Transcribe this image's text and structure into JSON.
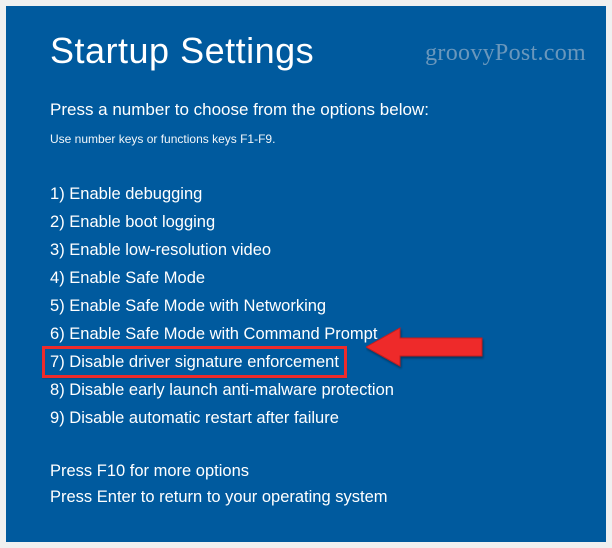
{
  "title": "Startup Settings",
  "subtitle": "Press a number to choose from the options below:",
  "hint": "Use number keys or functions keys F1-F9.",
  "options": [
    {
      "n": "1",
      "label": "Enable debugging"
    },
    {
      "n": "2",
      "label": "Enable boot logging"
    },
    {
      "n": "3",
      "label": "Enable low-resolution video"
    },
    {
      "n": "4",
      "label": "Enable Safe Mode"
    },
    {
      "n": "5",
      "label": "Enable Safe Mode with Networking"
    },
    {
      "n": "6",
      "label": "Enable Safe Mode with Command Prompt"
    },
    {
      "n": "7",
      "label": "Disable driver signature enforcement"
    },
    {
      "n": "8",
      "label": "Disable early launch anti-malware protection"
    },
    {
      "n": "9",
      "label": "Disable automatic restart after failure"
    }
  ],
  "highlighted_index": 6,
  "footer": {
    "line1": "Press F10 for more options",
    "line2": "Press Enter to return to your operating system"
  },
  "watermark": "groovyPost.com",
  "colors": {
    "background": "#005a9e",
    "text": "#ffffff",
    "highlight_border": "#ee2b2b",
    "arrow": "#ee2b2b"
  }
}
